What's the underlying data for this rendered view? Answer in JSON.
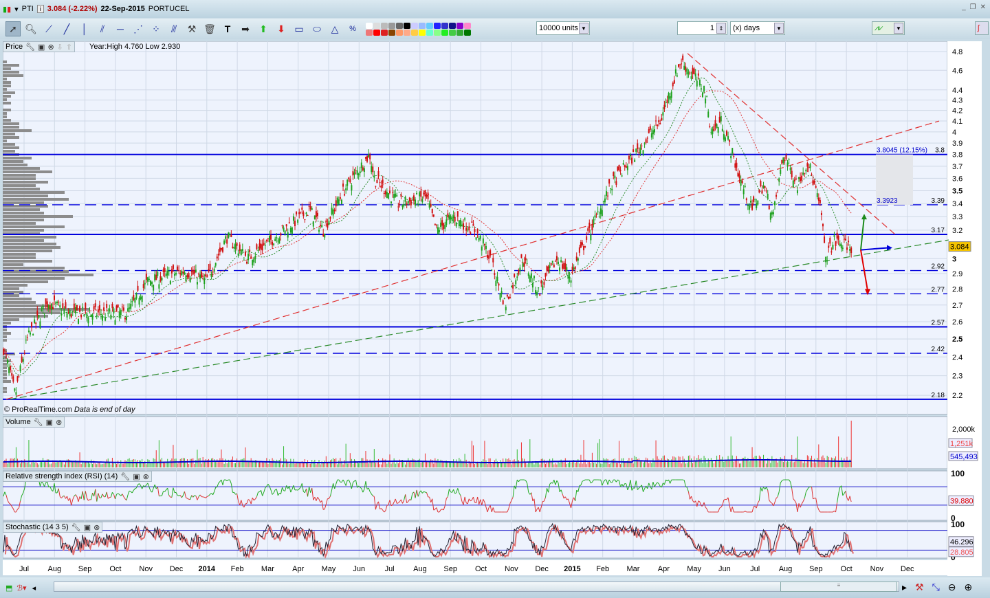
{
  "window": {
    "ticker": "PTI",
    "price": "3.084 (-2.22%)",
    "date": "22-Sep-2015",
    "name": "PORTUCEL"
  },
  "toolbar": {
    "units": "10000 units",
    "period_value": "1",
    "period_unit": "(x) days"
  },
  "price_panel": {
    "label": "Price",
    "info": "Year:High 4.760 Low 2.930",
    "watermark": "© ProRealTime.com",
    "note": "Data is end of day",
    "last_price": "3.084"
  },
  "volume_panel": {
    "label": "Volume",
    "last": "1,251k",
    "avg": "545,493"
  },
  "rsi_panel": {
    "label": "Relative strength index (RSI) (14)",
    "value": "39.880",
    "ticks": [
      "100",
      "0"
    ]
  },
  "stoch_panel": {
    "label": "Stochastic (14 3 5)",
    "k": "46.296",
    "d": "28.805",
    "ticks": [
      "100",
      "0"
    ]
  },
  "colors": {
    "up": "#1fa11f",
    "down": "#d01010",
    "line_blue": "#0000dd",
    "bg": "#eef3fd"
  },
  "chart_data": {
    "type": "candlestick",
    "title": "PTI PORTUCEL daily",
    "x_unit": "months since Jul 2013",
    "x_ticks": [
      "Jul",
      "Aug",
      "Sep",
      "Oct",
      "Nov",
      "Dec",
      "2014",
      "Feb",
      "Mar",
      "Apr",
      "May",
      "Jun",
      "Jul",
      "Aug",
      "Sep",
      "Oct",
      "Nov",
      "Dec",
      "2015",
      "Feb",
      "Mar",
      "Apr",
      "May",
      "Jun",
      "Jul",
      "Aug",
      "Sep",
      "Oct",
      "Nov",
      "Dec"
    ],
    "y_ticks": [
      "4.8",
      "4.6",
      "4.4",
      "4.3",
      "4.2",
      "4.1",
      "4",
      "3.9",
      "3.8",
      "3.7",
      "3.6",
      "3.5",
      "3.4",
      "3.3",
      "3.2",
      "3",
      "2.9",
      "2.8",
      "2.7",
      "2.6",
      "2.5",
      "2.4",
      "2.3",
      "2.2"
    ],
    "ylim": [
      2.2,
      4.8
    ],
    "price_path": [
      [
        -0.68,
        2.45
      ],
      [
        -0.29,
        2.2
      ],
      [
        0.11,
        2.5
      ],
      [
        0.79,
        2.72
      ],
      [
        1.47,
        2.65
      ],
      [
        2.37,
        2.65
      ],
      [
        3.39,
        2.65
      ],
      [
        4.06,
        2.85
      ],
      [
        5.3,
        2.92
      ],
      [
        5.98,
        2.85
      ],
      [
        6.66,
        3.15
      ],
      [
        7.34,
        3.0
      ],
      [
        8.24,
        3.15
      ],
      [
        9.37,
        3.35
      ],
      [
        9.82,
        3.2
      ],
      [
        10.5,
        3.5
      ],
      [
        11.35,
        3.8
      ],
      [
        11.5,
        3.6
      ],
      [
        12.3,
        3.4
      ],
      [
        13.2,
        3.45
      ],
      [
        13.54,
        3.2
      ],
      [
        14.1,
        3.3
      ],
      [
        14.8,
        3.2
      ],
      [
        15.2,
        3.05
      ],
      [
        15.8,
        2.7
      ],
      [
        16.37,
        3.0
      ],
      [
        16.9,
        2.78
      ],
      [
        17.5,
        3.0
      ],
      [
        17.95,
        2.88
      ],
      [
        18.6,
        3.2
      ],
      [
        19.3,
        3.55
      ],
      [
        20.2,
        3.85
      ],
      [
        20.9,
        4.1
      ],
      [
        21.56,
        4.7
      ],
      [
        22.35,
        4.4
      ],
      [
        22.57,
        4.0
      ],
      [
        22.9,
        4.1
      ],
      [
        23.5,
        3.6
      ],
      [
        23.9,
        3.35
      ],
      [
        24.27,
        3.55
      ],
      [
        24.6,
        3.3
      ],
      [
        24.94,
        3.8
      ],
      [
        25.4,
        3.55
      ],
      [
        25.73,
        3.75
      ],
      [
        26.2,
        3.3
      ],
      [
        26.3,
        3.0
      ],
      [
        26.6,
        3.12
      ],
      [
        27.16,
        3.084
      ]
    ],
    "levels": [
      {
        "value": 3.8,
        "style": "solid",
        "label": "3.8"
      },
      {
        "value": 3.39,
        "style": "dashed",
        "label": "3.39"
      },
      {
        "value": 3.17,
        "style": "solid",
        "label": "3.17"
      },
      {
        "value": 2.92,
        "style": "dashed",
        "label": "2.92"
      },
      {
        "value": 2.77,
        "style": "dashed",
        "label": "2.77"
      },
      {
        "value": 2.57,
        "style": "solid",
        "label": "2.57"
      },
      {
        "value": 2.42,
        "style": "dashed",
        "label": "2.42"
      },
      {
        "value": 2.18,
        "style": "solid",
        "label": "2.18"
      }
    ],
    "annotations": [
      "3.8045 (12.15%)",
      "3.3923"
    ]
  }
}
